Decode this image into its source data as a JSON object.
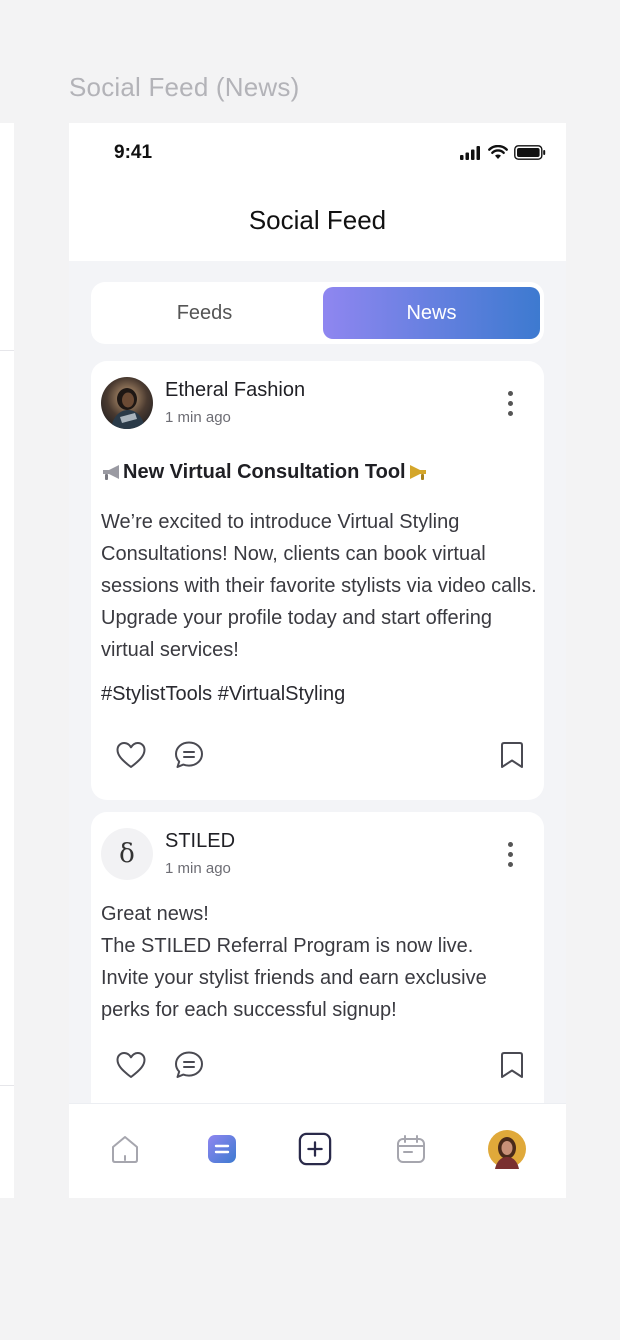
{
  "frame_title": "Social Feed (News)",
  "status_bar": {
    "time": "9:41"
  },
  "header": {
    "title": "Social Feed"
  },
  "tabs": [
    {
      "label": "Feeds",
      "active": false
    },
    {
      "label": "News",
      "active": true
    }
  ],
  "posts": [
    {
      "author": "Etheral Fashion",
      "time_ago": "1 min ago",
      "headline": "New Virtual Consultation Tool",
      "body": "We’re excited to introduce Virtual Styling Consultations! Now, clients can book virtual sessions with their favorite stylists via video calls. Upgrade your profile today and start offering virtual services!",
      "hashtags": "#StylistTools #VirtualStyling",
      "icons": {
        "like": "heart-icon",
        "comment": "comment-icon",
        "save": "bookmark-icon",
        "more": "more-vertical-icon"
      }
    },
    {
      "author": "STILED",
      "time_ago": "1 min ago",
      "avatar_glyph": "δ",
      "body_lines": [
        "Great news!",
        "The STILED Referral Program is now live.",
        "Invite your stylist friends and earn exclusive perks for each successful signup!"
      ],
      "icons": {
        "like": "heart-icon",
        "comment": "comment-icon",
        "save": "bookmark-icon",
        "more": "more-vertical-icon"
      }
    }
  ],
  "bottom_nav": [
    {
      "icon": "home-icon",
      "active": false
    },
    {
      "icon": "feed-icon",
      "active": true
    },
    {
      "icon": "add-icon",
      "active": false
    },
    {
      "icon": "calendar-icon",
      "active": false
    },
    {
      "icon": "profile-avatar-icon",
      "active": false
    }
  ],
  "colors": {
    "accent_start": "#8f86f0",
    "accent_end": "#3d7ad0",
    "background": "#f3f4f7",
    "card": "#ffffff"
  }
}
